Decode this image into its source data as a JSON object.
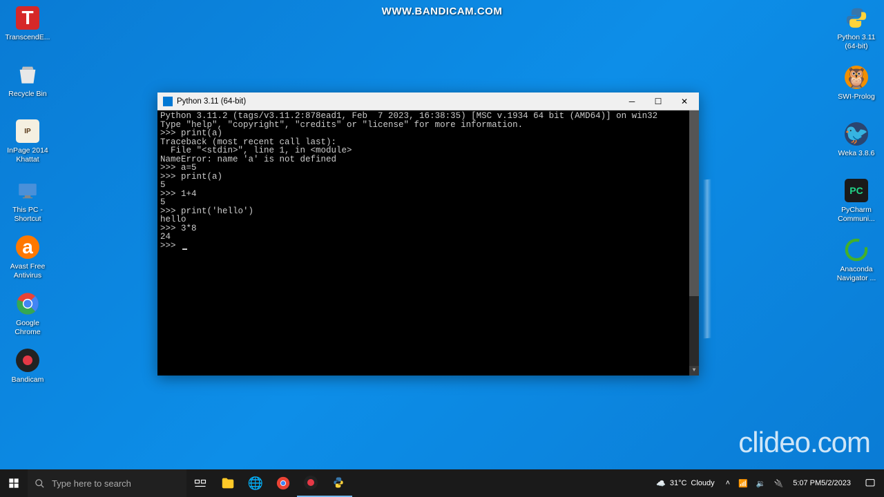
{
  "watermarks": {
    "top": "WWW.BANDICAM.COM",
    "bottom": "clideo.com"
  },
  "desktop_icons_left": [
    {
      "label": "TranscendE...",
      "key": "transcend"
    },
    {
      "label": "Recycle Bin",
      "key": "recycle-bin"
    },
    {
      "label": "InPage 2014 Khattat",
      "key": "inpage"
    },
    {
      "label": "This PC - Shortcut",
      "key": "this-pc"
    },
    {
      "label": "Avast Free Antivirus",
      "key": "avast"
    },
    {
      "label": "Google Chrome",
      "key": "chrome"
    },
    {
      "label": "Bandicam",
      "key": "bandicam"
    }
  ],
  "desktop_icons_right": [
    {
      "label": "Python 3.11 (64-bit)",
      "key": "python"
    },
    {
      "label": "SWI-Prolog",
      "key": "swi-prolog"
    },
    {
      "label": "Weka 3.8.6",
      "key": "weka"
    },
    {
      "label": "PyCharm Communi...",
      "key": "pycharm"
    },
    {
      "label": "Anaconda Navigator ...",
      "key": "anaconda"
    }
  ],
  "console": {
    "title": "Python 3.11 (64-bit)",
    "lines": [
      "Python 3.11.2 (tags/v3.11.2:878ead1, Feb  7 2023, 16:38:35) [MSC v.1934 64 bit (AMD64)] on win32",
      "Type \"help\", \"copyright\", \"credits\" or \"license\" for more information.",
      ">>> print(a)",
      "Traceback (most recent call last):",
      "  File \"<stdin>\", line 1, in <module>",
      "NameError: name 'a' is not defined",
      ">>> a=5",
      ">>> print(a)",
      "5",
      ">>> 1+4",
      "5",
      ">>> print('hello')",
      "hello",
      ">>> 3*8",
      "24",
      ">>> "
    ]
  },
  "taskbar": {
    "search_placeholder": "Type here to search",
    "weather_temp": "31°C",
    "weather_cond": "Cloudy",
    "time": "5:07 PM",
    "date": "5/2/2023"
  }
}
